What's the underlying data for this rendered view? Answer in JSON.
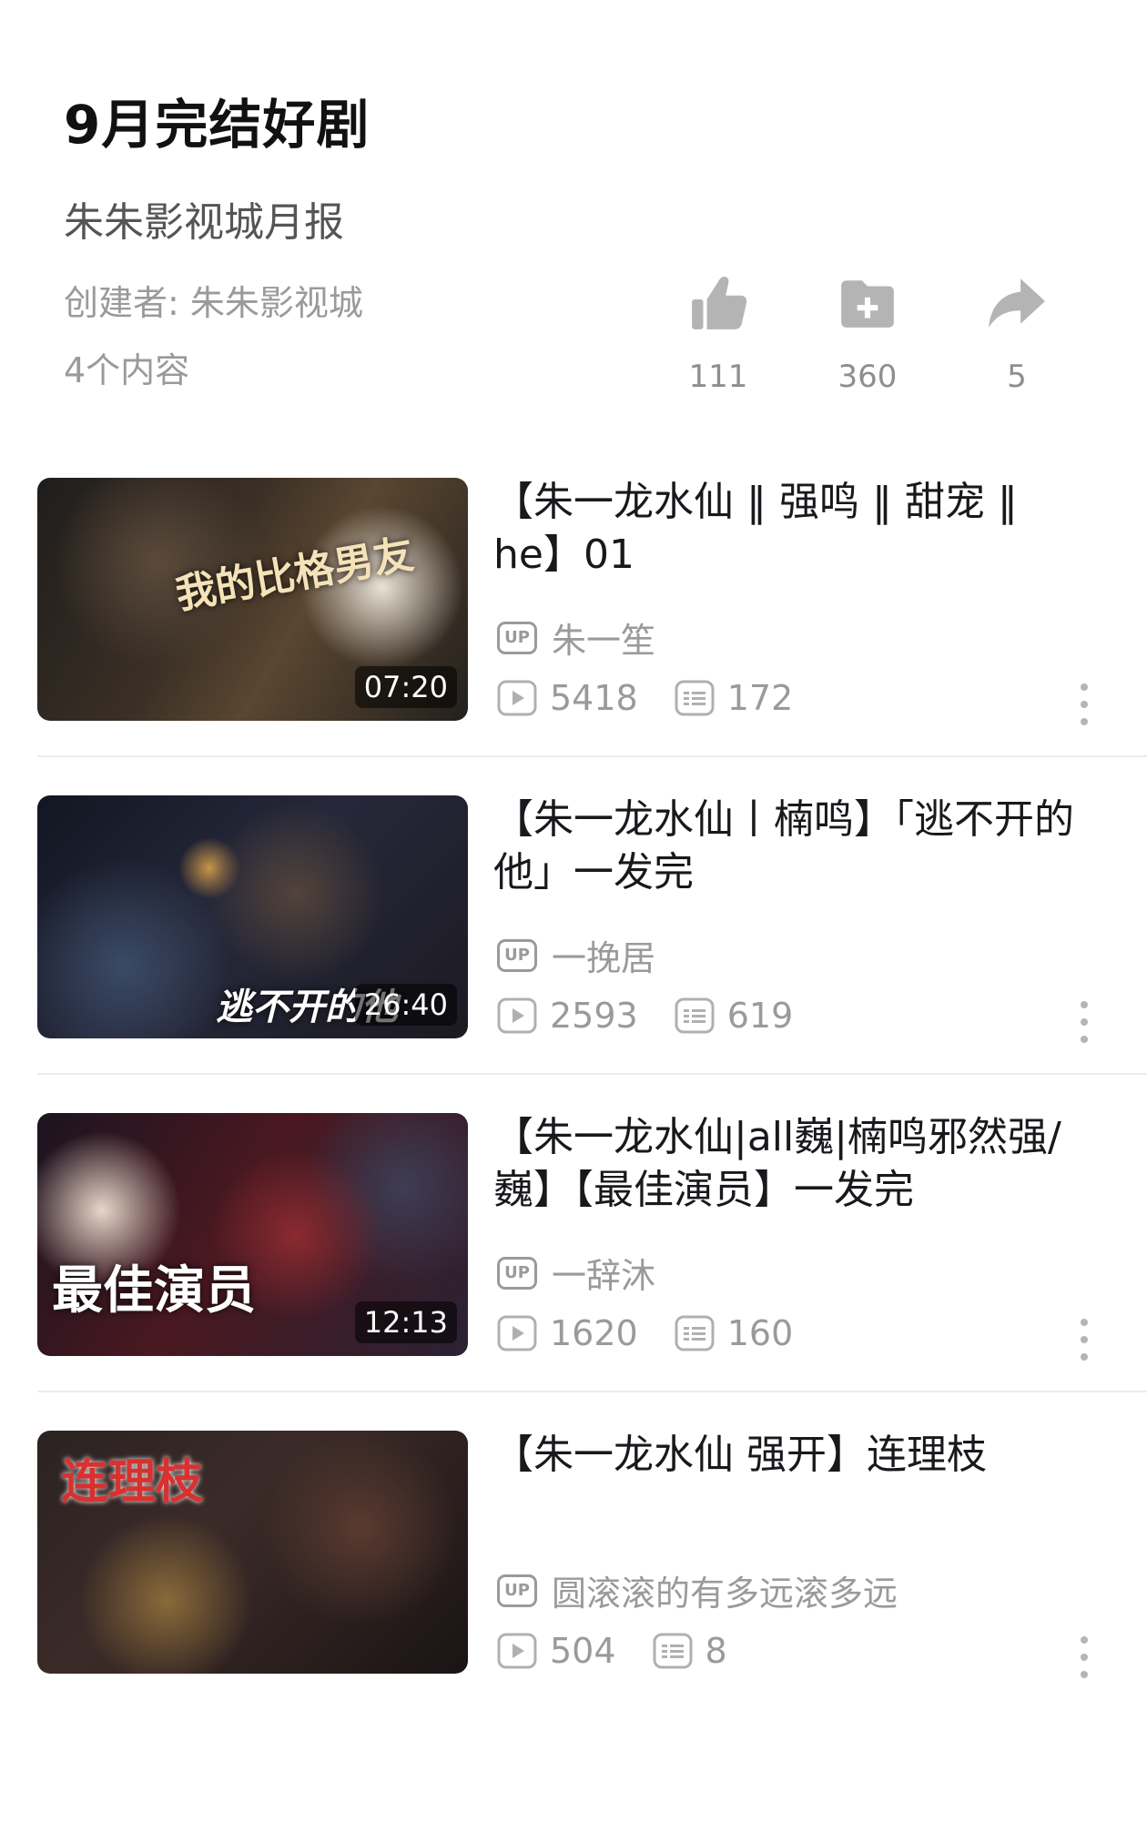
{
  "header": {
    "title": "9月完结好剧",
    "subtitle": "朱朱影视城月报",
    "creator": "创建者: 朱朱影视城",
    "count": "4个内容"
  },
  "actions": {
    "like": "111",
    "favorite": "360",
    "share": "5"
  },
  "videos": [
    {
      "title": "【朱一龙水仙 ‖ 强鸣 ‖ 甜宠 ‖ he】01",
      "uploader": "朱一笙",
      "views": "5418",
      "comments": "172",
      "duration": "07:20",
      "thumb_text": "我的比格男友"
    },
    {
      "title": "【朱一龙水仙丨楠鸣】「逃不开的他」一发完",
      "uploader": "一挽居",
      "views": "2593",
      "comments": "619",
      "duration": "26:40",
      "thumb_text": "逃不开的他"
    },
    {
      "title": "【朱一龙水仙|all巍|楠鸣邪然强/巍】【最佳演员】一发完",
      "uploader": "一辞沐",
      "views": "1620",
      "comments": "160",
      "duration": "12:13",
      "thumb_text": "最佳演员"
    },
    {
      "title": "【朱一龙水仙 强开】连理枝",
      "uploader": "圆滚滚的有多远滚多远",
      "views": "504",
      "comments": "8",
      "duration": "",
      "thumb_text": "连理枝"
    }
  ],
  "badge": {
    "up": "UP"
  },
  "colors": {
    "icon": "#b4b4b4",
    "text_muted": "#9a9a9a"
  }
}
